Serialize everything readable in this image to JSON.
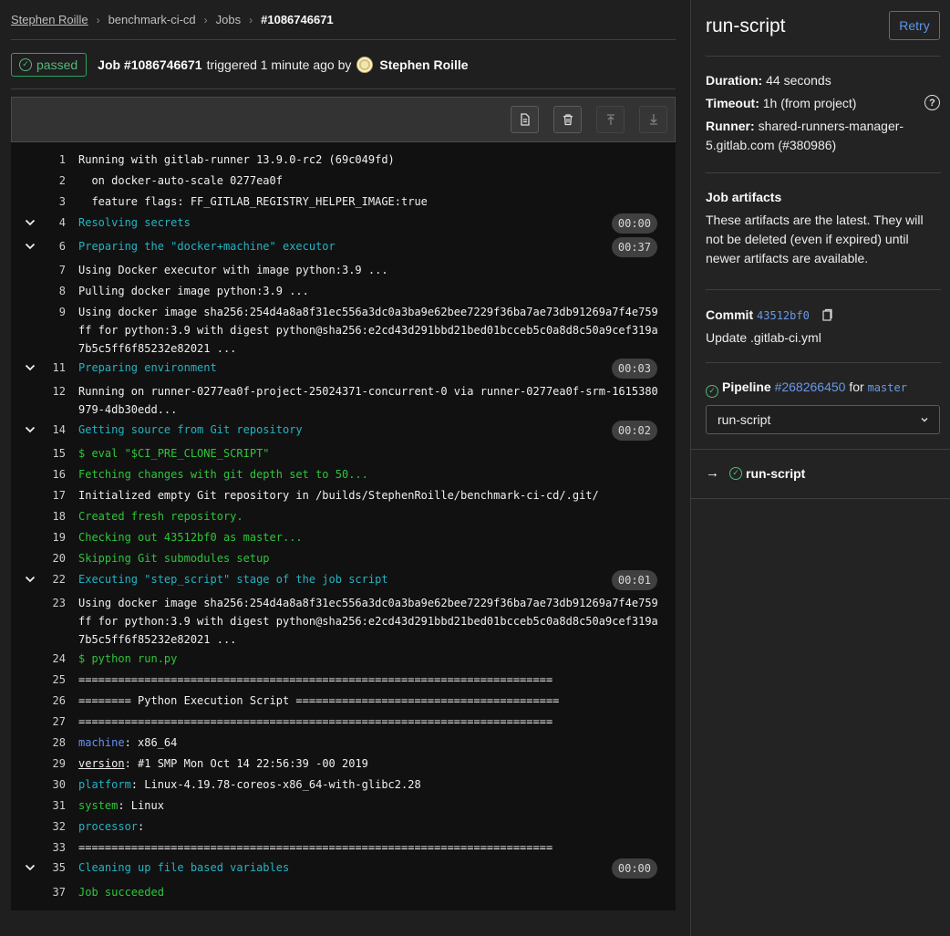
{
  "breadcrumb": {
    "items": [
      "Stephen Roille",
      "benchmark-ci-cd",
      "Jobs",
      "#1086746671"
    ]
  },
  "header": {
    "status": "passed",
    "job_label": "Job #1086746671",
    "triggered_text": "triggered 1 minute ago by",
    "user": "Stephen Roille"
  },
  "toolbar": {
    "icons": [
      "raw-log-icon",
      "erase-log-icon",
      "scroll-top-icon",
      "scroll-bottom-icon"
    ]
  },
  "log": {
    "lines": [
      {
        "n": "1",
        "text": "Running with gitlab-runner 13.9.0-rc2 (69c049fd)",
        "style": ""
      },
      {
        "n": "2",
        "text": "  on docker-auto-scale 0277ea0f",
        "style": ""
      },
      {
        "n": "3",
        "text": "  feature flags: FF_GITLAB_REGISTRY_HELPER_IMAGE:true",
        "style": ""
      },
      {
        "n": "4",
        "text": "Resolving secrets",
        "style": "cyan",
        "section": true,
        "duration": "00:00"
      },
      {
        "n": "6",
        "text": "Preparing the \"docker+machine\" executor",
        "style": "cyan",
        "section": true,
        "duration": "00:37"
      },
      {
        "n": "7",
        "text": "Using Docker executor with image python:3.9 ...",
        "style": ""
      },
      {
        "n": "8",
        "text": "Pulling docker image python:3.9 ...",
        "style": ""
      },
      {
        "n": "9",
        "text": "Using docker image sha256:254d4a8a8f31ec556a3dc0a3ba9e62bee7229f36ba7ae73db91269a7f4e759ff for python:3.9 with digest python@sha256:e2cd43d291bbd21bed01bcceb5c0a8d8c50a9cef319a7b5c5ff6f85232e82021 ...",
        "style": ""
      },
      {
        "n": "11",
        "text": "Preparing environment",
        "style": "cyan",
        "section": true,
        "duration": "00:03"
      },
      {
        "n": "12",
        "text": "Running on runner-0277ea0f-project-25024371-concurrent-0 via runner-0277ea0f-srm-1615380979-4db30edd...",
        "style": ""
      },
      {
        "n": "14",
        "text": "Getting source from Git repository",
        "style": "cyan",
        "section": true,
        "duration": "00:02"
      },
      {
        "n": "15",
        "text": "$ eval \"$CI_PRE_CLONE_SCRIPT\"",
        "style": "green"
      },
      {
        "n": "16",
        "text": "Fetching changes with git depth set to 50...",
        "style": "green"
      },
      {
        "n": "17",
        "text": "Initialized empty Git repository in /builds/StephenRoille/benchmark-ci-cd/.git/",
        "style": ""
      },
      {
        "n": "18",
        "text": "Created fresh repository.",
        "style": "green"
      },
      {
        "n": "19",
        "text": "Checking out 43512bf0 as master...",
        "style": "green"
      },
      {
        "n": "20",
        "text": "Skipping Git submodules setup",
        "style": "green"
      },
      {
        "n": "22",
        "text": "Executing \"step_script\" stage of the job script",
        "style": "cyan",
        "section": true,
        "duration": "00:01"
      },
      {
        "n": "23",
        "text": "Using docker image sha256:254d4a8a8f31ec556a3dc0a3ba9e62bee7229f36ba7ae73db91269a7f4e759ff for python:3.9 with digest python@sha256:e2cd43d291bbd21bed01bcceb5c0a8d8c50a9cef319a7b5c5ff6f85232e82021 ...",
        "style": ""
      },
      {
        "n": "24",
        "text": "$ python run.py",
        "style": "green"
      },
      {
        "n": "25",
        "text": "========================================================================",
        "style": ""
      },
      {
        "n": "26",
        "text": "======== Python Execution Script ========================================",
        "style": ""
      },
      {
        "n": "27",
        "text": "========================================================================",
        "style": ""
      },
      {
        "n": "28",
        "key": "machine",
        "value": ": x86_64",
        "keystyle": "blue"
      },
      {
        "n": "29",
        "key": "version",
        "value": ": #1 SMP Mon Oct 14 22:56:39 -00 2019",
        "keystyle": "underline"
      },
      {
        "n": "30",
        "key": "platform",
        "value": ": Linux-4.19.78-coreos-x86_64-with-glibc2.28",
        "keystyle": "cyan"
      },
      {
        "n": "31",
        "key": "system",
        "value": ": Linux",
        "keystyle": "green"
      },
      {
        "n": "32",
        "key": "processor",
        "value": ":",
        "keystyle": "cyan"
      },
      {
        "n": "33",
        "text": "========================================================================",
        "style": ""
      },
      {
        "n": "35",
        "text": "Cleaning up file based variables",
        "style": "cyan",
        "section": true,
        "duration": "00:00"
      },
      {
        "n": "37",
        "text": "Job succeeded",
        "style": "green"
      }
    ]
  },
  "sidebar": {
    "title": "run-script",
    "retry_label": "Retry",
    "duration_label": "Duration:",
    "duration_value": "44 seconds",
    "timeout_label": "Timeout:",
    "timeout_value": "1h (from project)",
    "runner_label": "Runner:",
    "runner_value": "shared-runners-manager-5.gitlab.com (#380986)",
    "artifacts_title": "Job artifacts",
    "artifacts_text": "These artifacts are the latest. They will not be deleted (even if expired) until newer artifacts are available.",
    "commit_label": "Commit",
    "commit_hash": "43512bf0",
    "commit_message": "Update .gitlab-ci.yml",
    "pipeline_label": "Pipeline",
    "pipeline_id": "#268266450",
    "pipeline_for": "for",
    "pipeline_branch": "master",
    "stage_select": "run-script",
    "job_name": "run-script"
  },
  "colors": {
    "success": "#52b87a",
    "link": "#6a98e8",
    "log_cyan": "#25b3c3",
    "log_green": "#2ec53b",
    "log_blue": "#6a8ff2"
  }
}
